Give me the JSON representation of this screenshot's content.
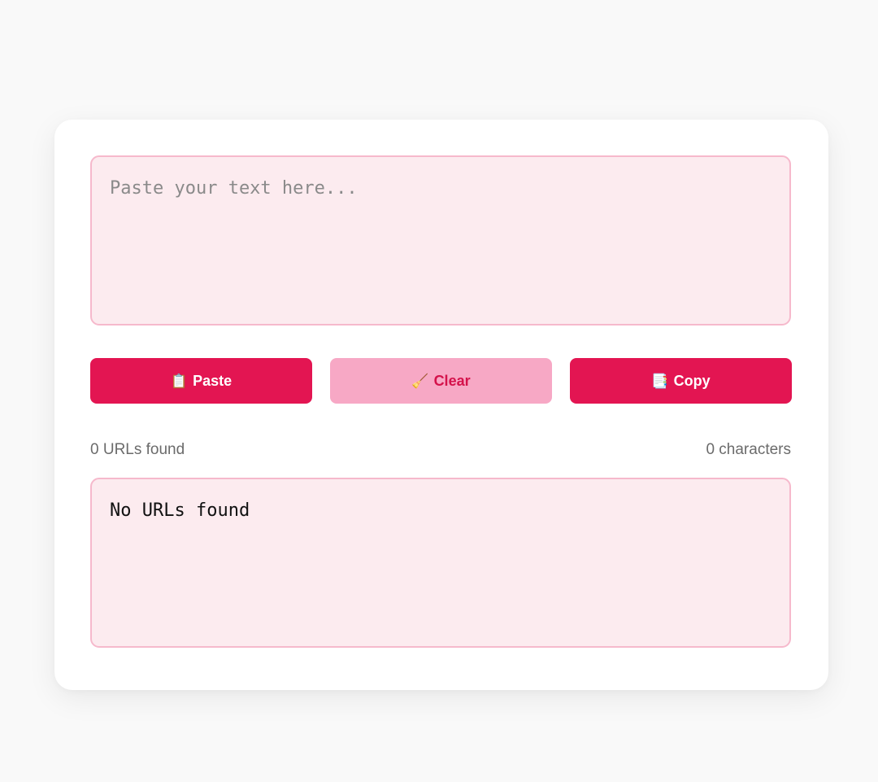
{
  "input": {
    "placeholder": "Paste your text here...",
    "value": ""
  },
  "buttons": {
    "paste": {
      "icon": "clipboard-icon",
      "glyph": "📋",
      "label": "Paste"
    },
    "clear": {
      "icon": "broom-icon",
      "glyph": "🧹",
      "label": "Clear"
    },
    "copy": {
      "icon": "copy-icon",
      "glyph": "📑",
      "label": "Copy"
    }
  },
  "stats": {
    "urls_found": "0 URLs found",
    "characters": "0 characters"
  },
  "output": {
    "value": "No URLs found"
  },
  "colors": {
    "page_background": "#f9f9f9",
    "card_background": "#ffffff",
    "field_background": "#fcebef",
    "field_border": "#f6b9cc",
    "primary_button": "#e31552",
    "secondary_button": "#f7a8c5",
    "secondary_button_text": "#d4124b",
    "stats_text": "#6b6b6b"
  }
}
